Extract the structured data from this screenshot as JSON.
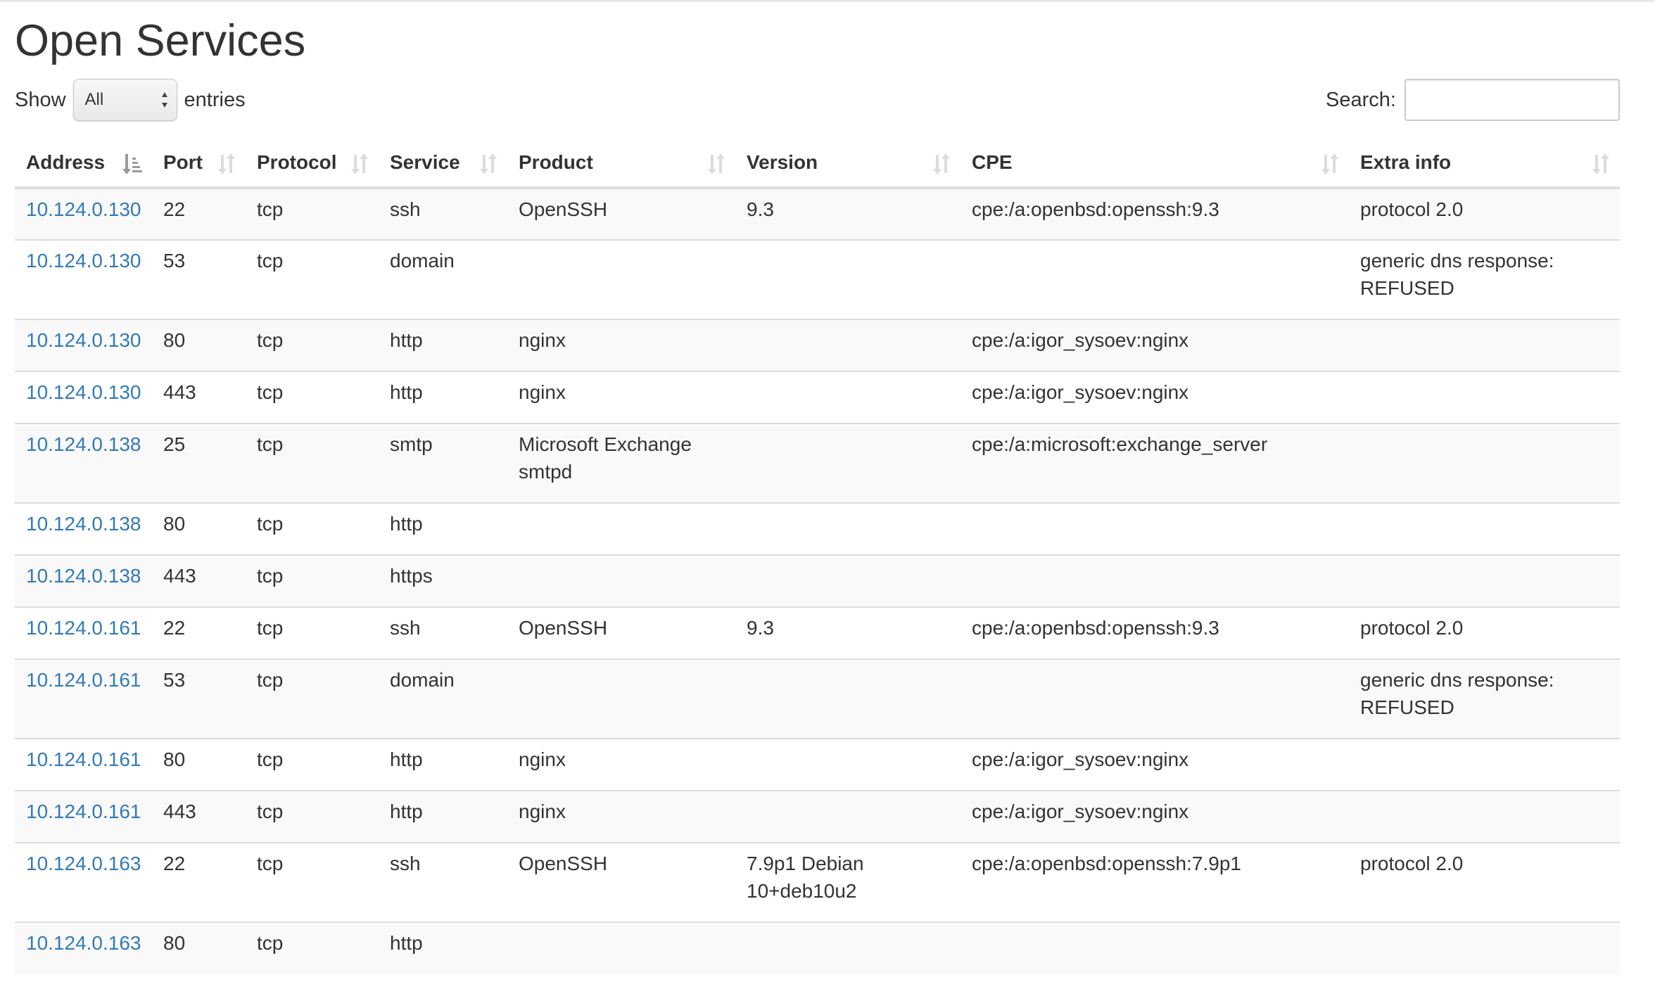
{
  "page_title": "Open Services",
  "length_control": {
    "prefix": "Show",
    "selected": "All",
    "suffix": "entries"
  },
  "search": {
    "label": "Search:",
    "value": ""
  },
  "columns": [
    {
      "label": "Address",
      "sort": "ascending"
    },
    {
      "label": "Port",
      "sort": "both"
    },
    {
      "label": "Protocol",
      "sort": "both"
    },
    {
      "label": "Service",
      "sort": "both"
    },
    {
      "label": "Product",
      "sort": "both"
    },
    {
      "label": "Version",
      "sort": "both"
    },
    {
      "label": "CPE",
      "sort": "both"
    },
    {
      "label": "Extra info",
      "sort": "both"
    }
  ],
  "rows": [
    {
      "address": "10.124.0.130",
      "port": "22",
      "protocol": "tcp",
      "service": "ssh",
      "product": "OpenSSH",
      "version": "9.3",
      "cpe": "cpe:/a:openbsd:openssh:9.3",
      "extra": "protocol 2.0"
    },
    {
      "address": "10.124.0.130",
      "port": "53",
      "protocol": "tcp",
      "service": "domain",
      "product": "",
      "version": "",
      "cpe": "",
      "extra": "generic dns response: REFUSED"
    },
    {
      "address": "10.124.0.130",
      "port": "80",
      "protocol": "tcp",
      "service": "http",
      "product": "nginx",
      "version": "",
      "cpe": "cpe:/a:igor_sysoev:nginx",
      "extra": ""
    },
    {
      "address": "10.124.0.130",
      "port": "443",
      "protocol": "tcp",
      "service": "http",
      "product": "nginx",
      "version": "",
      "cpe": "cpe:/a:igor_sysoev:nginx",
      "extra": ""
    },
    {
      "address": "10.124.0.138",
      "port": "25",
      "protocol": "tcp",
      "service": "smtp",
      "product": "Microsoft Exchange smtpd",
      "version": "",
      "cpe": "cpe:/a:microsoft:exchange_server",
      "extra": ""
    },
    {
      "address": "10.124.0.138",
      "port": "80",
      "protocol": "tcp",
      "service": "http",
      "product": "",
      "version": "",
      "cpe": "",
      "extra": ""
    },
    {
      "address": "10.124.0.138",
      "port": "443",
      "protocol": "tcp",
      "service": "https",
      "product": "",
      "version": "",
      "cpe": "",
      "extra": ""
    },
    {
      "address": "10.124.0.161",
      "port": "22",
      "protocol": "tcp",
      "service": "ssh",
      "product": "OpenSSH",
      "version": "9.3",
      "cpe": "cpe:/a:openbsd:openssh:9.3",
      "extra": "protocol 2.0"
    },
    {
      "address": "10.124.0.161",
      "port": "53",
      "protocol": "tcp",
      "service": "domain",
      "product": "",
      "version": "",
      "cpe": "",
      "extra": "generic dns response: REFUSED"
    },
    {
      "address": "10.124.0.161",
      "port": "80",
      "protocol": "tcp",
      "service": "http",
      "product": "nginx",
      "version": "",
      "cpe": "cpe:/a:igor_sysoev:nginx",
      "extra": ""
    },
    {
      "address": "10.124.0.161",
      "port": "443",
      "protocol": "tcp",
      "service": "http",
      "product": "nginx",
      "version": "",
      "cpe": "cpe:/a:igor_sysoev:nginx",
      "extra": ""
    },
    {
      "address": "10.124.0.163",
      "port": "22",
      "protocol": "tcp",
      "service": "ssh",
      "product": "OpenSSH",
      "version": "7.9p1 Debian 10+deb10u2",
      "cpe": "cpe:/a:openbsd:openssh:7.9p1",
      "extra": "protocol 2.0"
    },
    {
      "address": "10.124.0.163",
      "port": "80",
      "protocol": "tcp",
      "service": "http",
      "product": "",
      "version": "",
      "cpe": "",
      "extra": ""
    }
  ],
  "colors": {
    "link": "#337ab7",
    "text": "#333333",
    "row_stripe": "#f9f9f9",
    "border": "#dddddd",
    "sort_icon_inactive": "#dcdcdc",
    "sort_icon_active": "#9a9a9a"
  },
  "icons": {
    "sort_ascending": "sort-amount-asc-icon",
    "sort_both": "sort-both-icon",
    "select_arrows": "select-updown-icon"
  }
}
